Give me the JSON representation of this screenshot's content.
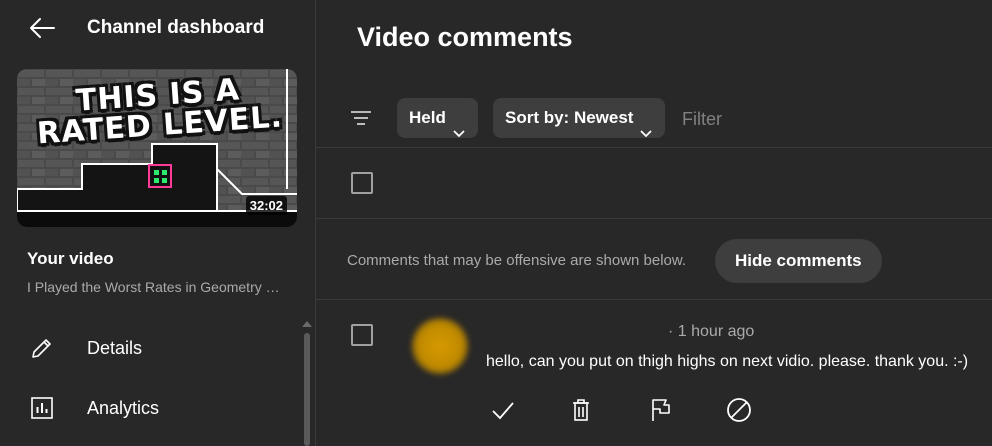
{
  "sidebar": {
    "title": "Channel dashboard",
    "thumbnail": {
      "caption": "THIS IS A RATED LEVEL.",
      "duration": "32:02"
    },
    "your_video_label": "Your video",
    "video_title": "I Played the Worst Rates in Geometry Dash",
    "nav": [
      {
        "label": "Details",
        "icon": "pencil-icon"
      },
      {
        "label": "Analytics",
        "icon": "analytics-icon"
      }
    ]
  },
  "main": {
    "title": "Video comments",
    "chips": {
      "held": "Held",
      "sort": "Sort by: Newest"
    },
    "filter_placeholder": "Filter",
    "notice": "Comments that may be offensive are shown below.",
    "hide_button": "Hide comments",
    "comment": {
      "meta": "· 1 hour ago",
      "text": "hello,  can you put on thigh highs on next vidio. please. thank you. :-)"
    }
  },
  "colors": {
    "background": "#282828",
    "chip": "#3e3e3e",
    "secondary_text": "#aaaaaa",
    "avatar": "#d69a00"
  }
}
